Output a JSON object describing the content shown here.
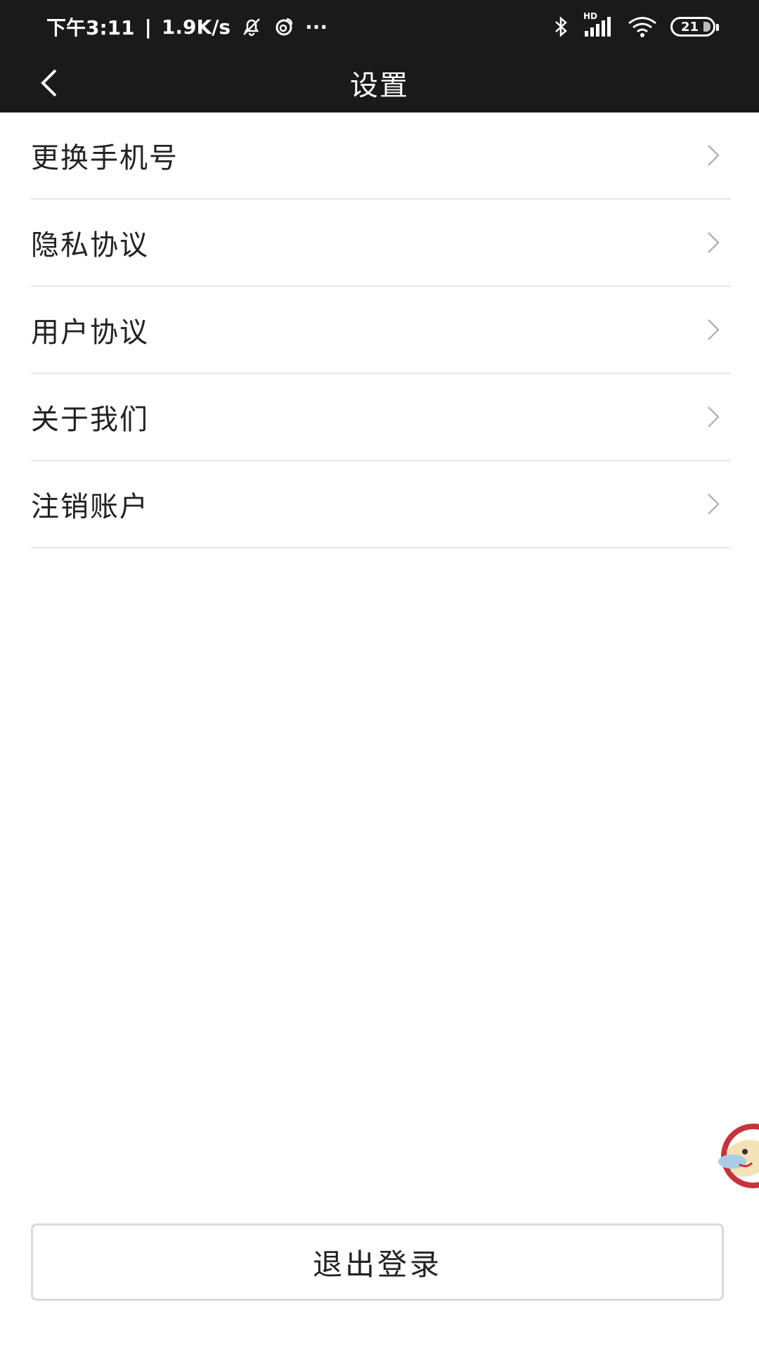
{
  "status_bar": {
    "time": "下午3:11",
    "separator": "|",
    "network_speed": "1.9K/s",
    "ellipsis": "···",
    "signal_label": "HD",
    "battery_level": "21",
    "icons": [
      "bell-off-icon",
      "weibo-icon",
      "bluetooth-icon",
      "signal-icon",
      "wifi-icon",
      "battery-icon"
    ]
  },
  "header": {
    "title": "设置",
    "back_icon": "chevron-left-icon"
  },
  "menu": {
    "items": [
      {
        "label": "更换手机号"
      },
      {
        "label": "隐私协议"
      },
      {
        "label": "用户协议"
      },
      {
        "label": "关于我们"
      },
      {
        "label": "注销账户"
      }
    ]
  },
  "footer": {
    "logout_label": "退出登录"
  },
  "colors": {
    "header_bg": "#1a1a1a",
    "text": "#222222",
    "divider": "#e6e6e6",
    "chevron": "#b3b3b3"
  }
}
